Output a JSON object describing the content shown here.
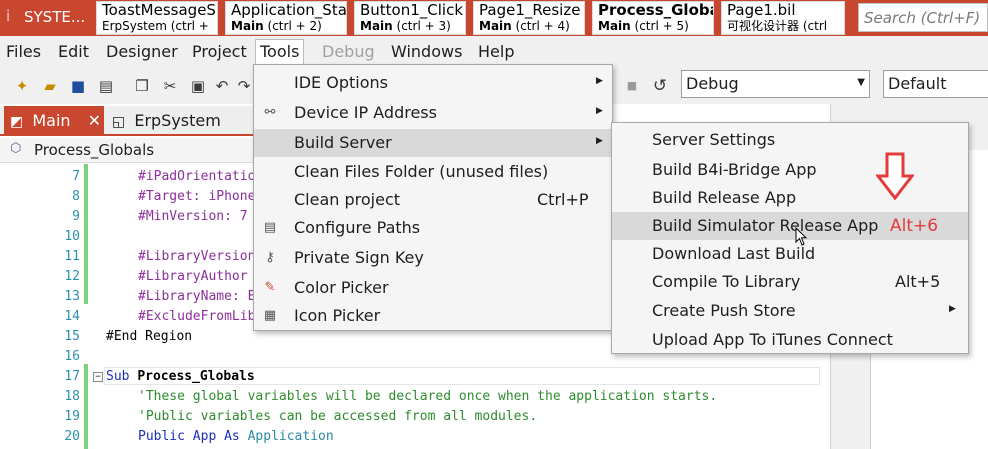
{
  "app": {
    "title": "SYSTE..."
  },
  "doc_tabs": [
    {
      "title": "ToastMessageS",
      "sub_name": "ErpSystem",
      "sub_key": "(ctrl +"
    },
    {
      "title": "Application_Sta",
      "sub_name": "Main",
      "sub_key": "(ctrl + 2)"
    },
    {
      "title": "Button1_Click",
      "sub_name": "Main",
      "sub_key": "(ctrl + 3)"
    },
    {
      "title": "Page1_Resize",
      "sub_name": "Main",
      "sub_key": "(ctrl + 4)"
    },
    {
      "title": "Process_Global",
      "sub_name": "Main",
      "sub_key": "(ctrl + 5)"
    },
    {
      "title": "Page1.bil",
      "sub_name": "可视化设计器",
      "sub_key": "(ctrl"
    }
  ],
  "search": {
    "placeholder": "Search (Ctrl+F)"
  },
  "menubar": [
    "Files",
    "Edit",
    "Designer",
    "Project",
    "Tools",
    "Debug",
    "Windows",
    "Help"
  ],
  "toolbar": {
    "config_combo": "Debug",
    "target_combo": "Default"
  },
  "editor_tabs": [
    {
      "label": "Main"
    },
    {
      "label": "ErpSystem"
    }
  ],
  "breadcrumb": "Process_Globals",
  "code_lines": [
    {
      "n": "7",
      "text": "#iPadOrientatio"
    },
    {
      "n": "8",
      "text": "#Target: iPhone"
    },
    {
      "n": "9",
      "text": "#MinVersion: 7"
    },
    {
      "n": "10",
      "text": ""
    },
    {
      "n": "11",
      "text": "#LibraryVersion"
    },
    {
      "n": "12",
      "text": "#LibraryAuthor"
    },
    {
      "n": "13",
      "text": "#LibraryName: E"
    },
    {
      "n": "14",
      "text": "#ExcludeFromLib"
    },
    {
      "n": "15",
      "text": "#End Region"
    },
    {
      "n": "16",
      "text": ""
    },
    {
      "n": "17",
      "kw": "Sub",
      "name": "Process_Globals"
    },
    {
      "n": "18",
      "text": "'These global variables will be declared once when the application starts."
    },
    {
      "n": "19",
      "text": "'Public variables can be accessed from all modules."
    },
    {
      "n": "20",
      "kw": "Public",
      "name": "App",
      "kw2": "As",
      "type": "Application"
    }
  ],
  "tools_menu": [
    {
      "label": "IDE Options",
      "submenu": true,
      "icon": ""
    },
    {
      "label": "Device IP Address",
      "submenu": true,
      "icon": "link-icon"
    },
    {
      "label": "Build Server",
      "submenu": true,
      "icon": ""
    },
    {
      "label": "Clean Files Folder (unused files)",
      "submenu": false,
      "icon": ""
    },
    {
      "label": "Clean project",
      "shortcut": "Ctrl+P",
      "submenu": false,
      "icon": ""
    },
    {
      "label": "Configure Paths",
      "submenu": false,
      "icon": "paths-icon"
    },
    {
      "label": "Private Sign Key",
      "submenu": false,
      "icon": "key-icon"
    },
    {
      "label": "Color Picker",
      "submenu": false,
      "icon": "color-picker-icon"
    },
    {
      "label": "Icon Picker",
      "submenu": false,
      "icon": "icon-picker-icon"
    }
  ],
  "build_server_menu": [
    {
      "label": "Server Settings"
    },
    {
      "label": "Build B4i-Bridge App"
    },
    {
      "label": "Build Release App"
    },
    {
      "label": "Build Simulator Release App"
    },
    {
      "label": "Download Last Build"
    },
    {
      "label": "Compile To Library",
      "shortcut": "Alt+5"
    },
    {
      "label": "Create Push Store",
      "submenu": true
    },
    {
      "label": "Upload App To iTunes Connect"
    }
  ],
  "annotation": {
    "shortcut_text": "Alt+6",
    "color": "#e23b3b"
  },
  "colors": {
    "accent": "#c8472e",
    "menu_highlight": "#d9d9d9",
    "line_number": "#2b91af"
  }
}
